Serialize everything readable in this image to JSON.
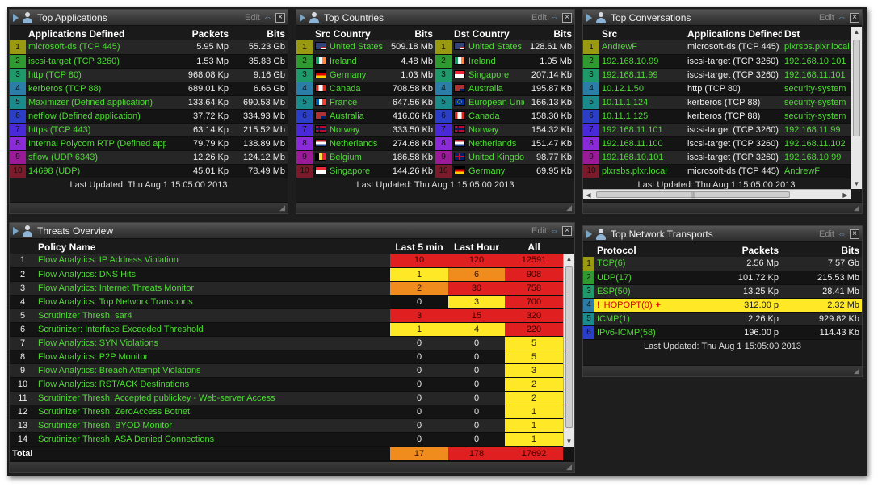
{
  "top_apps": {
    "title": "Top Applications",
    "edit": "Edit",
    "headers": [
      "Applications Defined",
      "Packets",
      "Bits"
    ],
    "rows": [
      [
        "microsoft-ds (TCP 445)",
        "5.95 Mp",
        "55.23 Gb"
      ],
      [
        "iscsi-target (TCP 3260)",
        "1.53 Mp",
        "35.83 Gb"
      ],
      [
        "http (TCP 80)",
        "968.08 Kp",
        "9.16 Gb"
      ],
      [
        "kerberos (TCP 88)",
        "689.01 Kp",
        "6.66 Gb"
      ],
      [
        "Maximizer (Defined application)",
        "133.64 Kp",
        "690.53 Mb"
      ],
      [
        "netflow (Defined application)",
        "37.72 Kp",
        "334.93 Mb"
      ],
      [
        "https (TCP 443)",
        "63.14 Kp",
        "215.52 Mb"
      ],
      [
        "Internal Polycom RTP (Defined application)",
        "79.79 Kp",
        "138.89 Mb"
      ],
      [
        "sflow (UDP 6343)",
        "12.26 Kp",
        "124.12 Mb"
      ],
      [
        "14698 (UDP)",
        "45.01 Kp",
        "78.49 Mb"
      ]
    ],
    "updated": "Last Updated: Thu Aug 1 15:05:00 2013"
  },
  "top_countries": {
    "title": "Top Countries",
    "edit": "Edit",
    "headers": [
      "Src Country",
      "Bits",
      "Dst Country",
      "Bits"
    ],
    "rows": [
      {
        "src": "United States",
        "src_flag": "us-flag",
        "src_bits": "509.18 Mb",
        "dst": "United States",
        "dst_flag": "us-flag",
        "dst_bits": "128.61 Mb"
      },
      {
        "src": "Ireland",
        "src_flag": "ireland-flag",
        "src_bits": "4.48 Mb",
        "dst": "Ireland",
        "dst_flag": "ireland-flag",
        "dst_bits": "1.05 Mb"
      },
      {
        "src": "Germany",
        "src_flag": "germany-flag",
        "src_bits": "1.03 Mb",
        "dst": "Singapore",
        "dst_flag": "singapore-flag",
        "dst_bits": "207.14 Kb"
      },
      {
        "src": "Canada",
        "src_flag": "canada-flag",
        "src_bits": "708.58 Kb",
        "dst": "Australia",
        "dst_flag": "australia-flag",
        "dst_bits": "195.87 Kb"
      },
      {
        "src": "France",
        "src_flag": "france-flag",
        "src_bits": "647.56 Kb",
        "dst": "European Union",
        "dst_flag": "eu-flag",
        "dst_bits": "166.13 Kb"
      },
      {
        "src": "Australia",
        "src_flag": "australia-flag",
        "src_bits": "416.06 Kb",
        "dst": "Canada",
        "dst_flag": "canada-flag",
        "dst_bits": "158.30 Kb"
      },
      {
        "src": "Norway",
        "src_flag": "norway-flag",
        "src_bits": "333.50 Kb",
        "dst": "Norway",
        "dst_flag": "norway-flag",
        "dst_bits": "154.32 Kb"
      },
      {
        "src": "Netherlands",
        "src_flag": "netherlands-flag",
        "src_bits": "274.68 Kb",
        "dst": "Netherlands",
        "dst_flag": "netherlands-flag",
        "dst_bits": "151.47 Kb"
      },
      {
        "src": "Belgium",
        "src_flag": "belgium-flag",
        "src_bits": "186.58 Kb",
        "dst": "United Kingdom",
        "dst_flag": "uk-flag",
        "dst_bits": "98.77 Kb"
      },
      {
        "src": "Singapore",
        "src_flag": "singapore-flag",
        "src_bits": "144.26 Kb",
        "dst": "Germany",
        "dst_flag": "germany-flag",
        "dst_bits": "69.95 Kb"
      }
    ],
    "updated": "Last Updated: Thu Aug 1 15:05:00 2013"
  },
  "top_conversations": {
    "title": "Top Conversations",
    "edit": "Edit",
    "headers": [
      "Src",
      "Applications Defined",
      "Dst"
    ],
    "rows": [
      [
        "AndrewF",
        "microsoft-ds (TCP 445)",
        "plxrsbs.plxr.local"
      ],
      [
        "192.168.10.99",
        "iscsi-target (TCP 3260)",
        "192.168.10.101"
      ],
      [
        "192.168.11.99",
        "iscsi-target (TCP 3260)",
        "192.168.11.101"
      ],
      [
        "10.12.1.50",
        "http (TCP 80)",
        "security-system"
      ],
      [
        "10.11.1.124",
        "kerberos (TCP 88)",
        "security-system"
      ],
      [
        "10.11.1.125",
        "kerberos (TCP 88)",
        "security-system"
      ],
      [
        "192.168.11.101",
        "iscsi-target (TCP 3260)",
        "192.168.11.99"
      ],
      [
        "192.168.11.100",
        "iscsi-target (TCP 3260)",
        "192.168.11.102"
      ],
      [
        "192.168.10.101",
        "iscsi-target (TCP 3260)",
        "192.168.10.99"
      ],
      [
        "plxrsbs.plxr.local",
        "microsoft-ds (TCP 445)",
        "AndrewF"
      ]
    ],
    "updated": "Last Updated: Thu Aug 1 15:05:00 2013"
  },
  "threats": {
    "title": "Threats Overview",
    "edit": "Edit",
    "headers": [
      "Policy Name",
      "Last 5 min",
      "Last Hour",
      "All"
    ],
    "rows": [
      {
        "rank": "1",
        "name": "Flow Analytics: IP Address Violation",
        "l5": "10",
        "l5_sev": "red",
        "lh": "120",
        "lh_sev": "red",
        "all": "12591",
        "all_sev": "red"
      },
      {
        "rank": "2",
        "name": "Flow Analytics: DNS Hits",
        "l5": "1",
        "l5_sev": "yellow",
        "lh": "6",
        "lh_sev": "orange",
        "all": "908",
        "all_sev": "red"
      },
      {
        "rank": "3",
        "name": "Flow Analytics: Internet Threats Monitor",
        "l5": "2",
        "l5_sev": "orange",
        "lh": "30",
        "lh_sev": "red",
        "all": "758",
        "all_sev": "red"
      },
      {
        "rank": "4",
        "name": "Flow Analytics: Top Network Transports",
        "l5": "0",
        "l5_sev": "black",
        "lh": "3",
        "lh_sev": "yellow",
        "all": "700",
        "all_sev": "red"
      },
      {
        "rank": "5",
        "name": "Scrutinizer Thresh: sar4",
        "l5": "3",
        "l5_sev": "red",
        "lh": "15",
        "lh_sev": "red",
        "all": "320",
        "all_sev": "red"
      },
      {
        "rank": "6",
        "name": "Scrutinizer: Interface Exceeded Threshold",
        "l5": "1",
        "l5_sev": "yellow",
        "lh": "4",
        "lh_sev": "yellow",
        "all": "220",
        "all_sev": "red"
      },
      {
        "rank": "7",
        "name": "Flow Analytics: SYN Violations",
        "l5": "0",
        "l5_sev": "none",
        "lh": "0",
        "lh_sev": "none",
        "all": "5",
        "all_sev": "yellow"
      },
      {
        "rank": "8",
        "name": "Flow Analytics: P2P Monitor",
        "l5": "0",
        "l5_sev": "none",
        "lh": "0",
        "lh_sev": "none",
        "all": "5",
        "all_sev": "yellow"
      },
      {
        "rank": "9",
        "name": "Flow Analytics: Breach Attempt Violations",
        "l5": "0",
        "l5_sev": "none",
        "lh": "0",
        "lh_sev": "none",
        "all": "3",
        "all_sev": "yellow"
      },
      {
        "rank": "10",
        "name": "Flow Analytics: RST/ACK Destinations",
        "l5": "0",
        "l5_sev": "none",
        "lh": "0",
        "lh_sev": "none",
        "all": "2",
        "all_sev": "yellow"
      },
      {
        "rank": "11",
        "name": "Scrutinizer Thresh: Accepted publickey - Web-server Access",
        "l5": "0",
        "l5_sev": "none",
        "lh": "0",
        "lh_sev": "none",
        "all": "2",
        "all_sev": "yellow"
      },
      {
        "rank": "12",
        "name": "Scrutinizer Thresh: ZeroAccess Botnet",
        "l5": "0",
        "l5_sev": "none",
        "lh": "0",
        "lh_sev": "none",
        "all": "1",
        "all_sev": "yellow"
      },
      {
        "rank": "13",
        "name": "Scrutinizer Thresh: BYOD Monitor",
        "l5": "0",
        "l5_sev": "none",
        "lh": "0",
        "lh_sev": "none",
        "all": "1",
        "all_sev": "yellow"
      },
      {
        "rank": "14",
        "name": "Scrutinizer Thresh: ASA Denied Connections",
        "l5": "0",
        "l5_sev": "none",
        "lh": "0",
        "lh_sev": "none",
        "all": "1",
        "all_sev": "yellow"
      }
    ],
    "total": {
      "label": "Total",
      "l5": "17",
      "lh": "178",
      "all": "17692"
    }
  },
  "transports": {
    "title": "Top Network Transports",
    "edit": "Edit",
    "headers": [
      "Protocol",
      "Packets",
      "Bits"
    ],
    "rows": [
      {
        "name": "TCP(6)",
        "packets": "2.56 Mp",
        "bits": "7.57 Gb",
        "alert": false
      },
      {
        "name": "UDP(17)",
        "packets": "101.72 Kp",
        "bits": "215.53 Mb",
        "alert": false
      },
      {
        "name": "ESP(50)",
        "packets": "13.25 Kp",
        "bits": "28.41 Mb",
        "alert": false
      },
      {
        "name": "HOPOPT(0)",
        "packets": "312.00 p",
        "bits": "2.32 Mb",
        "alert": true,
        "alert_prefix": "!",
        "alert_suffix": "+"
      },
      {
        "name": "ICMP(1)",
        "packets": "2.26 Kp",
        "bits": "929.82 Kb",
        "alert": false
      },
      {
        "name": "IPv6-ICMP(58)",
        "packets": "196.00 p",
        "bits": "114.43 Kb",
        "alert": false
      }
    ],
    "updated": "Last Updated: Thu Aug 1 15:05:00 2013"
  },
  "colors": {
    "rank": [
      "#9a9a12",
      "#2f9a2f",
      "#1e9a6a",
      "#2a7ea8",
      "#1a8a8a",
      "#2a3ec8",
      "#4a2ad8",
      "#8a2ad8",
      "#9a1a9a",
      "#7a1a2a"
    ],
    "link_green": "#4ddc33",
    "severity_red": "#e02020",
    "severity_orange": "#f08c1e",
    "severity_yellow": "#ffe826",
    "alert_row": "#ffe826"
  }
}
